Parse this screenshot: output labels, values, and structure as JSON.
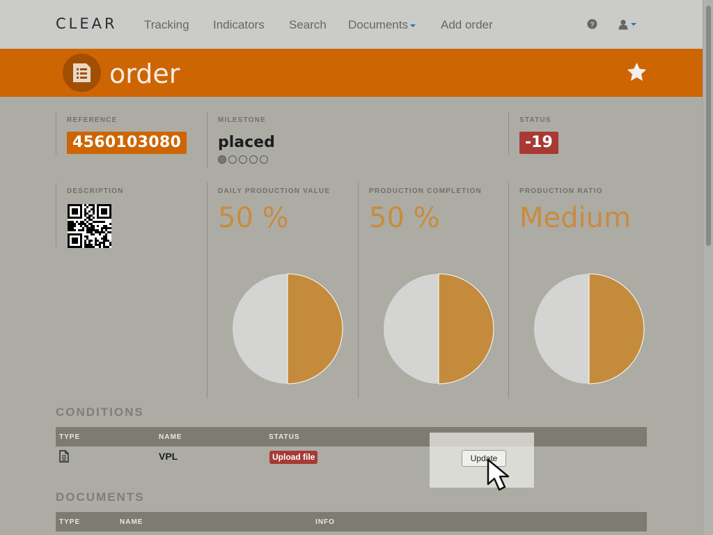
{
  "nav": {
    "brand": "CLEAR",
    "items": [
      "Tracking",
      "Indicators",
      "Search",
      "Documents",
      "Add order"
    ]
  },
  "header": {
    "title": "order"
  },
  "panels": {
    "reference": {
      "label": "REFERENCE",
      "value": "4560103080"
    },
    "milestone": {
      "label": "MILESTONE",
      "value": "placed",
      "steps_total": 5,
      "steps_done": 1
    },
    "status": {
      "label": "STATUS",
      "value": "-19"
    },
    "description": {
      "label": "DESCRIPTION"
    },
    "daily_production": {
      "label": "DAILY PRODUCTION VALUE",
      "value": "50 %",
      "fraction": 0.5
    },
    "production_completion": {
      "label": "PRODUCTION COMPLETION",
      "value": "50 %",
      "fraction": 0.5
    },
    "production_ratio": {
      "label": "PRODUCTION RATIO",
      "value": "Medium",
      "fraction": 0.5
    }
  },
  "conditions": {
    "title": "CONDITIONS",
    "headers": [
      "TYPE",
      "NAME",
      "STATUS"
    ],
    "rows": [
      {
        "name": "VPL",
        "status": "Upload file",
        "action": "Update"
      }
    ]
  },
  "documents": {
    "title": "DOCUMENTS",
    "headers": [
      "TYPE",
      "NAME",
      "INFO"
    ]
  },
  "colors": {
    "accent": "#cd6502",
    "danger": "#a73a34",
    "pie_fill": "#c48b3d",
    "pie_empty": "#d4d4d2"
  }
}
